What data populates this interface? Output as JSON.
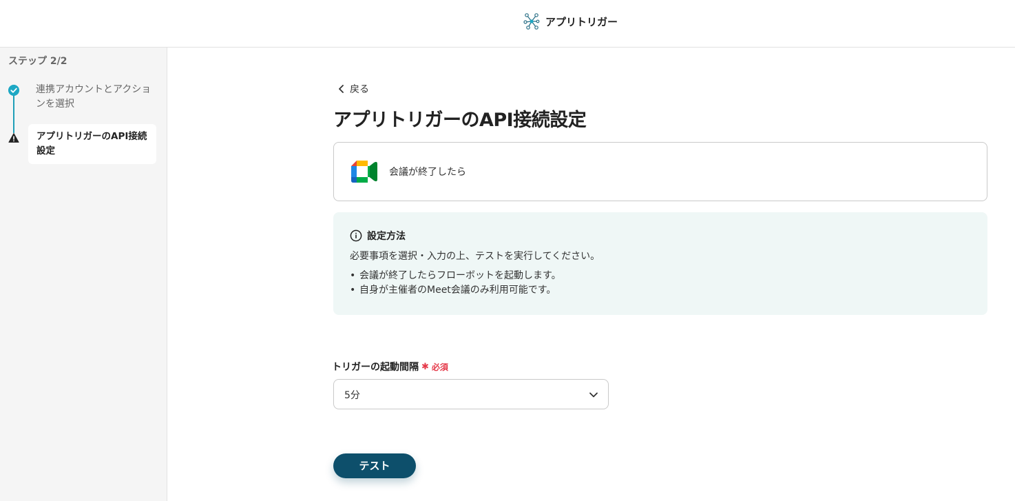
{
  "header": {
    "app_name": "アプリトリガー"
  },
  "sidebar": {
    "step_title": "ステップ 2/2",
    "steps": [
      {
        "label": "連携アカウントとアクションを選択",
        "status": "complete"
      },
      {
        "label": "アプリトリガーのAPI接続設定",
        "status": "current"
      }
    ]
  },
  "main": {
    "back_label": "戻る",
    "title": "アプリトリガーのAPI接続設定",
    "trigger_card": {
      "label": "会議が終了したら",
      "icon": "google-meet-icon"
    },
    "info": {
      "heading": "設定方法",
      "description": "必要事項を選択・入力の上、テストを実行してください。",
      "bullets": [
        "会議が終了したらフローボットを起動します。",
        "自身が主催者のMeet会議のみ利用可能です。"
      ]
    },
    "interval_field": {
      "label": "トリガーの起動間隔",
      "required_mark": "✱",
      "required_text": "必須",
      "value": "5分"
    },
    "test_button_label": "テスト"
  },
  "colors": {
    "primary": "#0d4f6b",
    "accent": "#1ea8c4",
    "required": "#e53a4a",
    "info_bg": "#eff7f6"
  }
}
